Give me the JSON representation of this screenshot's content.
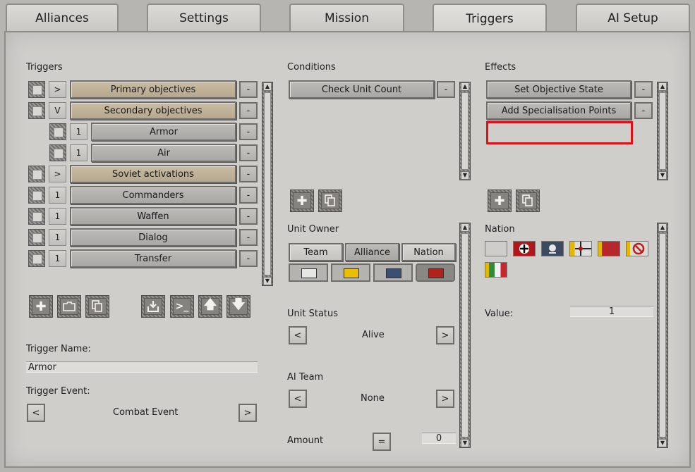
{
  "tabs": [
    "Alliances",
    "Settings",
    "Mission",
    "Triggers",
    "AI Setup"
  ],
  "active_tab": "Triggers",
  "triggers": {
    "heading": "Triggers",
    "items": [
      {
        "toggle": ">",
        "label": "Primary objectives"
      },
      {
        "toggle": "V",
        "label": "Secondary objectives"
      },
      {
        "toggle": "1",
        "label": "Armor"
      },
      {
        "toggle": "1",
        "label": "Air"
      },
      {
        "toggle": ">",
        "label": "Soviet activations"
      },
      {
        "toggle": "1",
        "label": "Commanders"
      },
      {
        "toggle": "1",
        "label": "Waffen"
      },
      {
        "toggle": "1",
        "label": "Dialog"
      },
      {
        "toggle": "1",
        "label": "Transfer"
      }
    ],
    "remove_label": "-",
    "name_label": "Trigger Name:",
    "name_value": "Armor",
    "event_label": "Trigger Event:",
    "event_value": "Combat Event",
    "prev": "<",
    "next": ">"
  },
  "conditions": {
    "heading": "Conditions",
    "items": [
      "Check Unit Count"
    ],
    "remove_label": "-",
    "unit_owner_label": "Unit Owner",
    "owner_options": [
      "Team",
      "Alliance",
      "Nation"
    ],
    "selected_owner": "Alliance",
    "team_colors": [
      "#e6e6e6",
      "#e8c000",
      "#3a4f72",
      "#b3211b"
    ],
    "unit_status_label": "Unit Status",
    "unit_status_value": "Alive",
    "ai_team_label": "AI Team",
    "ai_team_value": "None",
    "amount_label": "Amount",
    "amount_op": "=",
    "amount_value": "0",
    "prev": "<",
    "next": ">"
  },
  "effects": {
    "heading": "Effects",
    "items": [
      "Set Objective State",
      "Add Specialisation Points"
    ],
    "remove_label": "-",
    "nation_label": "Nation",
    "value_label": "Value:",
    "value": "1",
    "flags": [
      "neutral-flag",
      "german-flag",
      "ss-flag",
      "kriegsmarine-flag",
      "soviet-flag",
      "none-flag",
      "italian-flag"
    ]
  },
  "icons": [
    "plus-icon",
    "folder-icon",
    "copy-icon",
    "import-icon",
    "console-icon",
    "move-up-icon",
    "move-down-icon"
  ]
}
